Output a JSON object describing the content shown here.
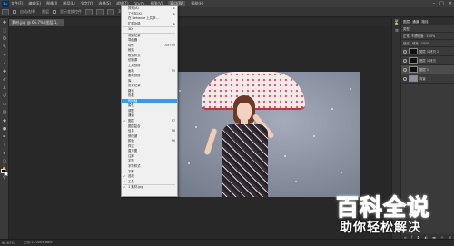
{
  "app": {
    "logo": "Ps"
  },
  "menubar": {
    "items": [
      "文件(F)",
      "编辑(E)",
      "图像(I)",
      "图层(L)",
      "文字(Y)",
      "选择(S)",
      "滤镜(T)",
      "3D(D)",
      "视图(V)",
      "窗口(W)",
      "帮助(H)"
    ],
    "active_index": 9,
    "window_controls": [
      "–",
      "□",
      "×"
    ]
  },
  "optionsbar": {
    "auto_select_label": "自动选择：",
    "layer_label": "图层",
    "transform_label": "显示变换控件",
    "mode_label": "3D 模式："
  },
  "document_tab": {
    "title": "素材.jpg @ 66.7% (图层 1, RGB/8)"
  },
  "window_menu": {
    "items": [
      {
        "label": "排列(A)",
        "shortcut": "▸"
      },
      {
        "label": "工作区(K)",
        "shortcut": "▸"
      },
      {
        "label": "在 Behance 上共享...",
        "shortcut": ""
      },
      {
        "label": "扩展功能",
        "shortcut": "▸"
      },
      {
        "label": "3D",
        "shortcut": ""
      },
      {
        "label": "测量记录",
        "shortcut": ""
      },
      {
        "label": "导航器",
        "shortcut": ""
      },
      {
        "label": "动作",
        "shortcut": "Alt+F9"
      },
      {
        "label": "段落",
        "shortcut": ""
      },
      {
        "label": "段落样式",
        "shortcut": ""
      },
      {
        "label": "仿制源",
        "shortcut": ""
      },
      {
        "label": "工具预设",
        "shortcut": ""
      },
      {
        "label": "画笔",
        "shortcut": "F5"
      },
      {
        "label": "画笔预设",
        "shortcut": ""
      },
      {
        "label": "库",
        "shortcut": ""
      },
      {
        "label": "历史记录",
        "shortcut": ""
      },
      {
        "label": "路径",
        "shortcut": ""
      },
      {
        "label": "色板",
        "shortcut": ""
      },
      {
        "label": "时间轴",
        "shortcut": "",
        "selected": true
      },
      {
        "label": "属性",
        "shortcut": ""
      },
      {
        "label": "调整",
        "shortcut": ""
      },
      {
        "label": "通道",
        "shortcut": ""
      },
      {
        "label": "图层",
        "shortcut": "F7",
        "checked": true
      },
      {
        "label": "图层复合",
        "shortcut": ""
      },
      {
        "label": "信息",
        "shortcut": "F8"
      },
      {
        "label": "修改键",
        "shortcut": ""
      },
      {
        "label": "颜色",
        "shortcut": "F6"
      },
      {
        "label": "样式",
        "shortcut": ""
      },
      {
        "label": "直方图",
        "shortcut": ""
      },
      {
        "label": "注释",
        "shortcut": ""
      },
      {
        "label": "字符",
        "shortcut": ""
      },
      {
        "label": "字符样式",
        "shortcut": ""
      },
      {
        "label": "字形",
        "shortcut": ""
      },
      {
        "label": "选项",
        "shortcut": "",
        "checked": true
      },
      {
        "label": "工具",
        "shortcut": "",
        "checked": true
      },
      {
        "label": "1 素材.jpg",
        "shortcut": "",
        "checked": true
      }
    ]
  },
  "layers_panel": {
    "tabs": [
      "图层",
      "通道",
      "路径"
    ],
    "kind_label": "类型",
    "blend_mode": "正常",
    "opacity_label": "不透明度:",
    "opacity_value": "100%",
    "lock_label": "锁定:",
    "fill_label": "填充:",
    "fill_value": "100%",
    "layers": [
      {
        "name": "图层 1 拷贝 2"
      },
      {
        "name": "图层 1 拷贝"
      },
      {
        "name": "图层 1",
        "active": true
      },
      {
        "name": "背景"
      }
    ],
    "footer_icons": [
      "link-icon",
      "fx-icon",
      "mask-icon",
      "adjust-icon",
      "folder-icon",
      "new-layer-icon",
      "trash-icon"
    ]
  },
  "statusbar": {
    "zoom": "66.67%",
    "doc_info": "文档:1.22M/4.88M"
  },
  "watermark": {
    "main": "百科全说",
    "sub": "助你轻松解决"
  }
}
